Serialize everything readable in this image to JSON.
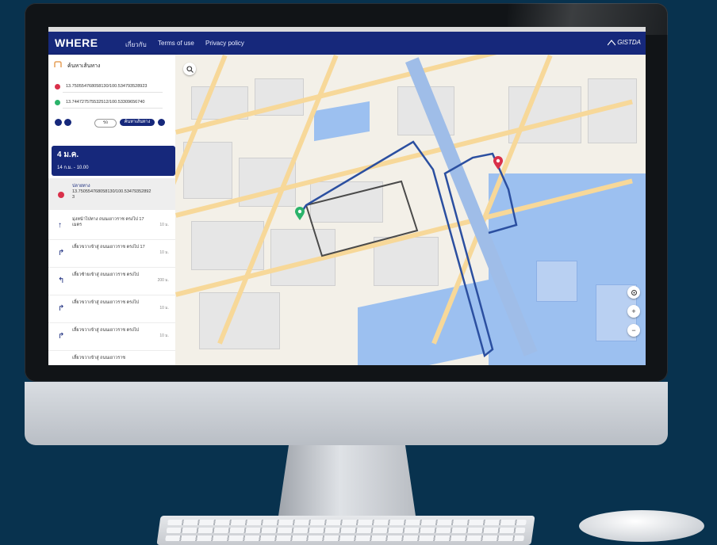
{
  "app": {
    "brand": "WHERE",
    "nav": [
      "เกี่ยวกับ",
      "Terms of use",
      "Privacy policy"
    ],
    "partner_logo": "GISTDA"
  },
  "sidebar": {
    "header_title": "ค้นหาเส้นทาง",
    "origin_coord": "13.750554768058130/100.534793528923",
    "destination_coord": "13.744727575532512/100.53309656740",
    "mode_buttons": [
      "รถ",
      "ค้นหาเส้นทาง"
    ],
    "summary": {
      "distance": "4 ม.ค.",
      "duration": "14 ก.ม. - 10.00"
    },
    "destination_block": {
      "label": "ปลายทาง",
      "coord": "13.750554768058130/100.534793528923"
    },
    "steps": [
      {
        "icon": "arrow-up-icon",
        "text": "มุ่งหน้าไปทาง ถนนเยาวราช ตรงไป 17 เมตร",
        "distance": "10 ม."
      },
      {
        "icon": "arrow-turn-right-icon",
        "text": "เลี้ยวขวาเข้าสู่ ถนนเยาวราช ตรงไป 17",
        "distance": "10 ม."
      },
      {
        "icon": "arrow-turn-left-icon",
        "text": "เลี้ยวซ้ายเข้าสู่ ถนนเยาวราช ตรงไป",
        "distance": "200 ม."
      },
      {
        "icon": "arrow-turn-right-icon",
        "text": "เลี้ยวขวาเข้าสู่ ถนนเยาวราช ตรงไป",
        "distance": "10 ม."
      },
      {
        "icon": "arrow-turn-right-icon",
        "text": "เลี้ยวขวาเข้าสู่ ถนนเยาวราช ตรงไป",
        "distance": "10 ม."
      }
    ],
    "steps_more": "เลี้ยวขวาเข้าสู่ ถนนเยาวราช"
  },
  "map": {
    "search_icon": "search-icon",
    "zoom_in": "+",
    "zoom_out": "−",
    "colors": {
      "route": "#2b4fa0",
      "route_alt": "#4a4a4a",
      "water": "#9cc0f0",
      "road": "#f7d899",
      "start_pin": "#2bb36a",
      "end_pin": "#d9304a"
    }
  }
}
